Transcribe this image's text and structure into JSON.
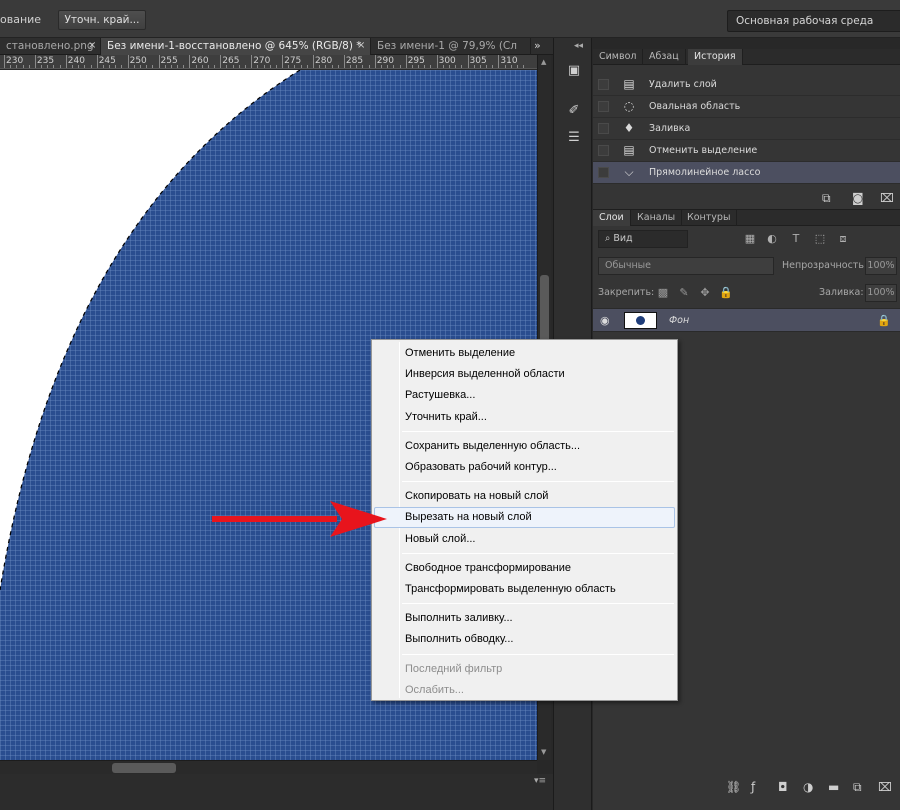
{
  "options_bar": {
    "partial_label": "ование",
    "refine_edge_button": "Уточн. край...",
    "workspace": "Основная рабочая среда"
  },
  "doc_tabs": [
    {
      "label": "становлено.png",
      "active": false
    },
    {
      "label": "Без имени-1-восстановлено @ 645% (RGB/8) *",
      "active": true
    },
    {
      "label": "Без имени-1 @ 79,9% (Сл",
      "active": false
    }
  ],
  "tab_close_glyph": "×",
  "tabs_overflow_glyph": "»",
  "ruler": {
    "labels": [
      "230",
      "235",
      "240",
      "245",
      "250",
      "255",
      "260",
      "265",
      "270",
      "275",
      "280",
      "285",
      "290",
      "295",
      "300",
      "305",
      "310"
    ]
  },
  "canvas": {
    "selection_fill_color": "#2a4d8f",
    "grid_color": "#6f8fc4",
    "background_color": "#ffffff"
  },
  "history_panel": {
    "tabs": [
      {
        "label": "Символ",
        "active": false
      },
      {
        "label": "Абзац",
        "active": false
      },
      {
        "label": "История",
        "active": true
      }
    ],
    "items": [
      {
        "label": "Удалить слой",
        "icon": "document-icon",
        "active": false
      },
      {
        "label": "Овальная область",
        "icon": "ellipse-marquee-icon",
        "active": false
      },
      {
        "label": "Заливка",
        "icon": "paint-bucket-icon",
        "active": false
      },
      {
        "label": "Отменить выделение",
        "icon": "document-icon",
        "active": false
      },
      {
        "label": "Прямолинейное лассо",
        "icon": "polygonal-lasso-icon",
        "active": true
      }
    ]
  },
  "layers_panel": {
    "tabs": [
      {
        "label": "Слои",
        "active": true
      },
      {
        "label": "Каналы",
        "active": false
      },
      {
        "label": "Контуры",
        "active": false
      }
    ],
    "kind_filter": "Вид",
    "blend_mode": "Обычные",
    "opacity_label": "Непрозрачность:",
    "opacity_value": "100%",
    "lock_label": "Закрепить:",
    "fill_label": "Заливка:",
    "fill_value": "100%",
    "layers": [
      {
        "name": "Фон",
        "visible": true,
        "locked": true
      }
    ]
  },
  "context_menu": {
    "groups": [
      [
        {
          "label": "Отменить выделение",
          "enabled": true
        },
        {
          "label": "Инверсия выделенной области",
          "enabled": true
        },
        {
          "label": "Растушевка...",
          "enabled": true
        },
        {
          "label": "Уточнить край...",
          "enabled": true
        }
      ],
      [
        {
          "label": "Сохранить выделенную область...",
          "enabled": true
        },
        {
          "label": "Образовать рабочий контур...",
          "enabled": true
        }
      ],
      [
        {
          "label": "Скопировать на новый слой",
          "enabled": true
        },
        {
          "label": "Вырезать на новый слой",
          "enabled": true,
          "highlighted": true
        },
        {
          "label": "Новый слой...",
          "enabled": true
        }
      ],
      [
        {
          "label": "Свободное трансформирование",
          "enabled": true
        },
        {
          "label": "Трансформировать выделенную область",
          "enabled": true
        }
      ],
      [
        {
          "label": "Выполнить заливку...",
          "enabled": true
        },
        {
          "label": "Выполнить обводку...",
          "enabled": true
        }
      ],
      [
        {
          "label": "Последний фильтр",
          "enabled": false
        },
        {
          "label": "Ослабить...",
          "enabled": false
        }
      ]
    ]
  },
  "annotation": {
    "arrow_color": "#e8141c"
  }
}
